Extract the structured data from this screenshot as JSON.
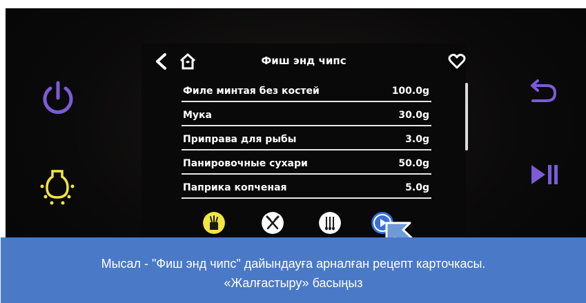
{
  "header": {
    "title": "Фиш энд чипс"
  },
  "ingredients": [
    {
      "name": "Филе минтая без костей",
      "amount": "100.0g"
    },
    {
      "name": "Мука",
      "amount": "30.0g"
    },
    {
      "name": "Приправа для рыбы",
      "amount": "3.0g"
    },
    {
      "name": "Панировочные сухари",
      "amount": "50.0g"
    },
    {
      "name": "Паприка копченая",
      "amount": "5.0g"
    }
  ],
  "caption": {
    "line1": "Мысал - \"Фиш энд чипс\" дайындауға арналған рецепт карточкасы.",
    "line2": "«Жалғастыру» басыңыз"
  },
  "icons": {
    "power": "power-icon",
    "light": "light-bulb-icon",
    "return": "return-icon",
    "play_pause": "play-pause-icon",
    "back": "chevron-left-icon",
    "home": "home-icon",
    "favorite": "heart-icon",
    "tools": [
      "ingredients-icon",
      "utensils-icon",
      "accessories-icon",
      "continue-play-icon"
    ]
  },
  "colors": {
    "accent_purple": "#7b5cd6",
    "accent_yellow": "#f2e640",
    "caption_blue": "#4a79c7",
    "active_blue": "#3a6fd8",
    "arrow_blue": "#6f9ad8"
  }
}
